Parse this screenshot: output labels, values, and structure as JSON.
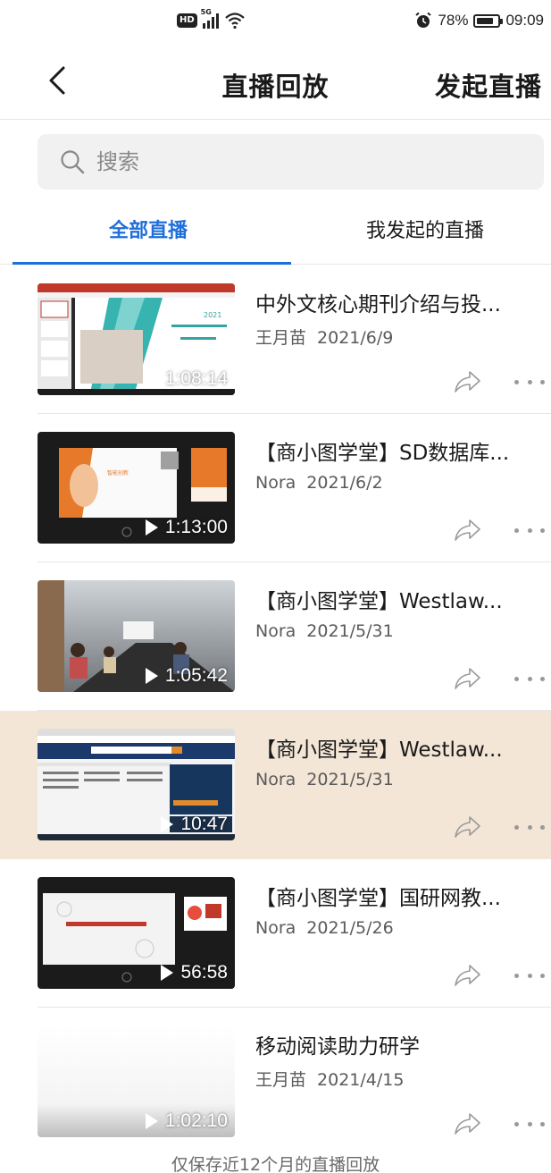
{
  "status_bar": {
    "hd": "HD",
    "network": "5G",
    "battery_text": "78%",
    "time": "09:09",
    "battery_level": 0.78
  },
  "nav": {
    "title": "直播回放",
    "action": "发起直播"
  },
  "search": {
    "placeholder": "搜索"
  },
  "tabs": [
    {
      "label": "全部直播",
      "active": true
    },
    {
      "label": "我发起的直播",
      "active": false
    }
  ],
  "items": [
    {
      "title": "中外文核心期刊介绍与投...",
      "author": "王月苗",
      "date": "2021/6/9",
      "duration": "1:08:14",
      "thumb": "slides-teal"
    },
    {
      "title": "【商小图学堂】SD数据库...",
      "author": "Nora",
      "date": "2021/6/2",
      "duration": "1:13:00",
      "thumb": "dark-orange"
    },
    {
      "title": "【商小图学堂】Westlaw...",
      "author": "Nora",
      "date": "2021/5/31",
      "duration": "1:05:42",
      "thumb": "classroom-photo"
    },
    {
      "title": "【商小图学堂】Westlaw...",
      "author": "Nora",
      "date": "2021/5/31",
      "duration": "10:47",
      "thumb": "westlaw-web",
      "highlighted": true
    },
    {
      "title": "【商小图学堂】国研网教...",
      "author": "Nora",
      "date": "2021/5/26",
      "duration": "56:58",
      "thumb": "dark-white-slide"
    },
    {
      "title": "移动阅读助力研学",
      "author": "王月苗",
      "date": "2021/4/15",
      "duration": "1:02:10",
      "thumb": "blank-white"
    }
  ],
  "footer_note": "仅保存近12个月的直播回放",
  "colors": {
    "accent": "#1e6fd9",
    "highlight_row": "#f3e6d6"
  }
}
